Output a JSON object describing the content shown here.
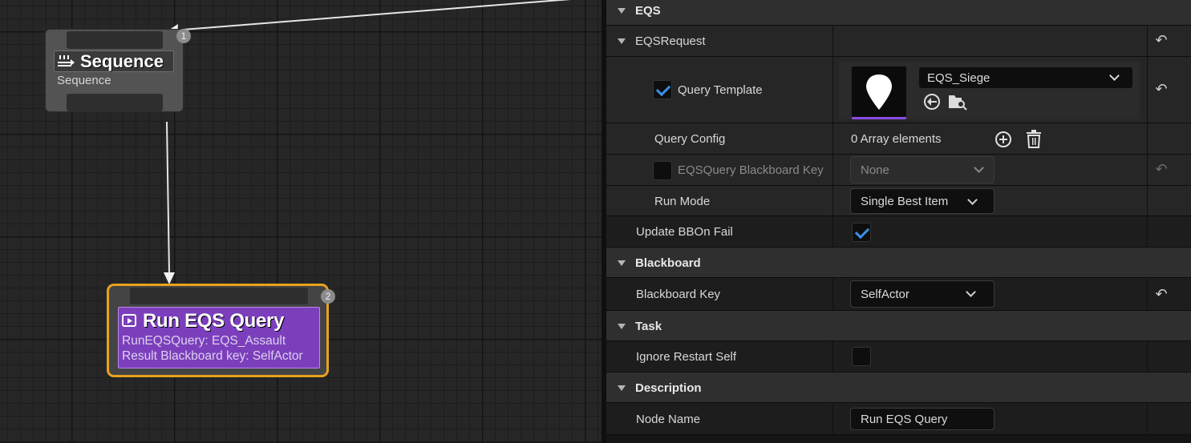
{
  "graph": {
    "sequence_node": {
      "title": "Sequence",
      "subtitle": "Sequence",
      "badge": "1"
    },
    "eqs_node": {
      "title": "Run EQS Query",
      "line1": "RunEQSQuery: EQS_Assault",
      "line2": "Result Blackboard key: SelfActor",
      "badge": "2"
    }
  },
  "details": {
    "sections": {
      "eqs": "EQS",
      "eqs_request": "EQSRequest",
      "blackboard": "Blackboard",
      "task": "Task",
      "description": "Description"
    },
    "query_template": {
      "label": "Query Template",
      "value": "EQS_Siege",
      "checked": true
    },
    "query_config": {
      "label": "Query Config",
      "value": "0 Array elements"
    },
    "eqs_blackboard_key": {
      "label": "EQSQuery Blackboard Key",
      "value": "None",
      "checked": false
    },
    "run_mode": {
      "label": "Run Mode",
      "value": "Single Best Item"
    },
    "update_bb_on_fail": {
      "label": "Update BBOn Fail",
      "checked": true
    },
    "blackboard_key": {
      "label": "Blackboard Key",
      "value": "SelfActor"
    },
    "ignore_restart_self": {
      "label": "Ignore Restart Self",
      "checked": false
    },
    "node_name": {
      "label": "Node Name",
      "value": "Run EQS Query"
    }
  },
  "colors": {
    "accent_blue": "#3a8fe8",
    "eqs_purple": "#7b3fbc",
    "selection_orange": "#e8a21e"
  }
}
